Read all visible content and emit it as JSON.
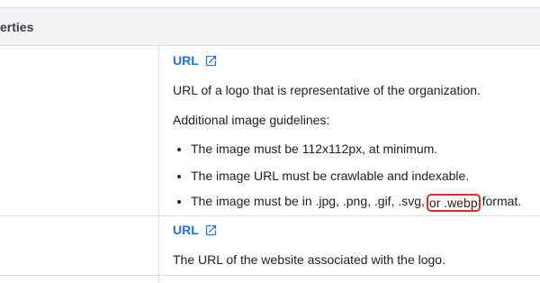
{
  "header": {
    "title": "erties"
  },
  "rows": [
    {
      "type_label": "URL",
      "description": "URL of a logo that is representative of the organization.",
      "guidelines_title": "Additional image guidelines:",
      "bullets": [
        "The image must be 112x112px, at minimum.",
        "The image URL must be crawlable and indexable."
      ],
      "format_bullet": {
        "before": "The image must be in .jpg, .png, .gif, .svg,",
        "highlight": "or .webp",
        "after": "format."
      }
    },
    {
      "type_label": "URL",
      "description": "The URL of the website associated with the logo."
    }
  ],
  "colors": {
    "link": "#1a73e8",
    "highlight_border": "#d93025",
    "header_bg": "#f1f3f4"
  },
  "icons": {
    "external_link": "open-in-new-icon"
  }
}
